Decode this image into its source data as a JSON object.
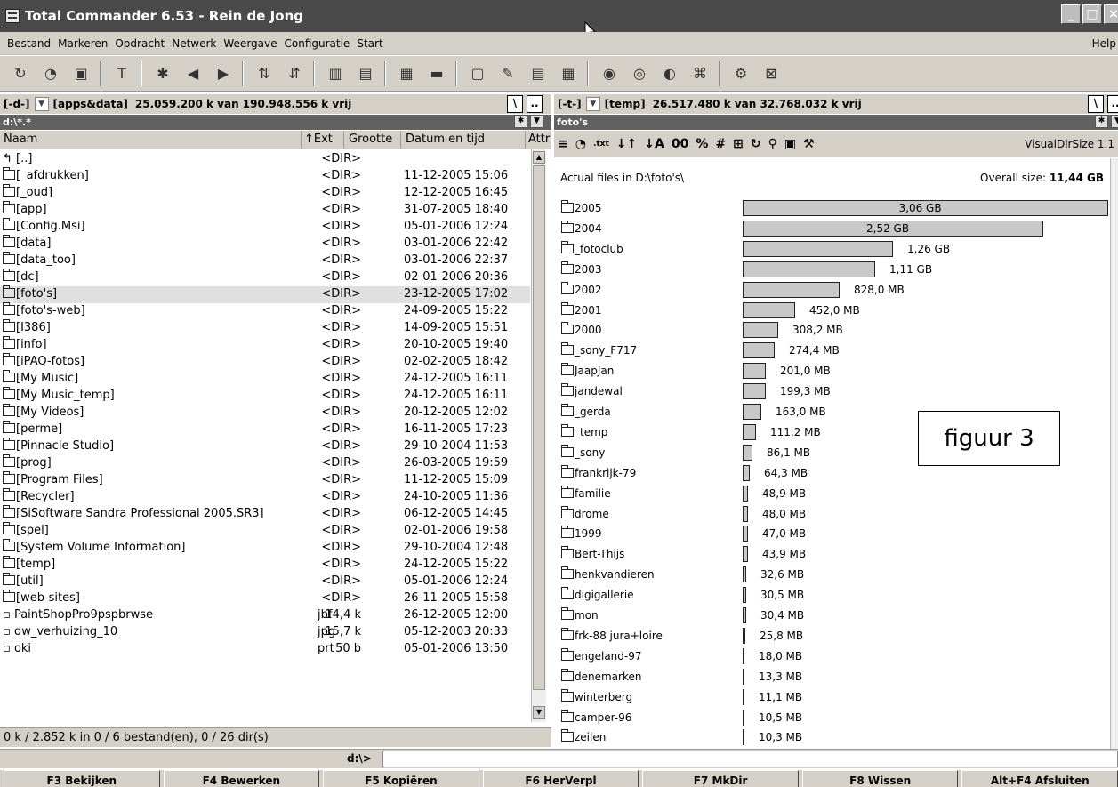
{
  "window": {
    "title": "Total Commander 6.53 - Rein de Jong"
  },
  "menu": {
    "items": [
      "Bestand",
      "Markeren",
      "Opdracht",
      "Netwerk",
      "Weergave",
      "Configuratie",
      "Start"
    ],
    "help": "Help"
  },
  "left": {
    "drive_label": "[-d-]",
    "volume": "[apps&data]",
    "space": "25.059.200 k van 190.948.556 k vrij",
    "path": "d:\\*.*",
    "headers": {
      "name": "Naam",
      "ext": "↑Ext",
      "size": "Grootte",
      "date": "Datum en tijd",
      "attr": "Attr"
    },
    "files": [
      {
        "name": "[..]",
        "ext": "",
        "size": "<DIR>",
        "date": "",
        "icon": "up"
      },
      {
        "name": "[_afdrukken]",
        "ext": "",
        "size": "<DIR>",
        "date": "11-12-2005 15:06",
        "icon": "folder"
      },
      {
        "name": "[_oud]",
        "ext": "",
        "size": "<DIR>",
        "date": "12-12-2005 16:45",
        "icon": "folder"
      },
      {
        "name": "[app]",
        "ext": "",
        "size": "<DIR>",
        "date": "31-07-2005 18:40",
        "icon": "folder"
      },
      {
        "name": "[Config.Msi]",
        "ext": "",
        "size": "<DIR>",
        "date": "05-01-2006 12:24",
        "icon": "folder"
      },
      {
        "name": "[data]",
        "ext": "",
        "size": "<DIR>",
        "date": "03-01-2006 22:42",
        "icon": "folder"
      },
      {
        "name": "[data_too]",
        "ext": "",
        "size": "<DIR>",
        "date": "03-01-2006 22:37",
        "icon": "folder"
      },
      {
        "name": "[dc]",
        "ext": "",
        "size": "<DIR>",
        "date": "02-01-2006 20:36",
        "icon": "folder"
      },
      {
        "name": "[foto's]",
        "ext": "",
        "size": "<DIR>",
        "date": "23-12-2005 17:02",
        "icon": "folder-special",
        "selected": true
      },
      {
        "name": "[foto's-web]",
        "ext": "",
        "size": "<DIR>",
        "date": "24-09-2005 15:22",
        "icon": "folder-special"
      },
      {
        "name": "[I386]",
        "ext": "",
        "size": "<DIR>",
        "date": "14-09-2005 15:51",
        "icon": "folder"
      },
      {
        "name": "[info]",
        "ext": "",
        "size": "<DIR>",
        "date": "20-10-2005 19:40",
        "icon": "folder"
      },
      {
        "name": "[iPAQ-fotos]",
        "ext": "",
        "size": "<DIR>",
        "date": "02-02-2005 18:42",
        "icon": "folder"
      },
      {
        "name": "[My Music]",
        "ext": "",
        "size": "<DIR>",
        "date": "24-12-2005 16:11",
        "icon": "folder"
      },
      {
        "name": "[My Music_temp]",
        "ext": "",
        "size": "<DIR>",
        "date": "24-12-2005 16:11",
        "icon": "folder"
      },
      {
        "name": "[My Videos]",
        "ext": "",
        "size": "<DIR>",
        "date": "20-12-2005 12:02",
        "icon": "folder"
      },
      {
        "name": "[perme]",
        "ext": "",
        "size": "<DIR>",
        "date": "16-11-2005 17:23",
        "icon": "folder"
      },
      {
        "name": "[Pinnacle Studio]",
        "ext": "",
        "size": "<DIR>",
        "date": "29-10-2004 11:53",
        "icon": "folder"
      },
      {
        "name": "[prog]",
        "ext": "",
        "size": "<DIR>",
        "date": "26-03-2005 19:59",
        "icon": "folder"
      },
      {
        "name": "[Program Files]",
        "ext": "",
        "size": "<DIR>",
        "date": "11-12-2005 15:09",
        "icon": "folder"
      },
      {
        "name": "[Recycler]",
        "ext": "",
        "size": "<DIR>",
        "date": "24-10-2005 11:36",
        "icon": "folder"
      },
      {
        "name": "[SiSoftware Sandra Professional 2005.SR3]",
        "ext": "",
        "size": "<DIR>",
        "date": "06-12-2005 14:45",
        "icon": "folder"
      },
      {
        "name": "[spel]",
        "ext": "",
        "size": "<DIR>",
        "date": "02-01-2006 19:58",
        "icon": "folder"
      },
      {
        "name": "[System Volume Information]",
        "ext": "",
        "size": "<DIR>",
        "date": "29-10-2004 12:48",
        "icon": "folder"
      },
      {
        "name": "[temp]",
        "ext": "",
        "size": "<DIR>",
        "date": "24-12-2005 15:22",
        "icon": "folder"
      },
      {
        "name": "[util]",
        "ext": "",
        "size": "<DIR>",
        "date": "05-01-2006 12:24",
        "icon": "folder"
      },
      {
        "name": "[web-sites]",
        "ext": "",
        "size": "<DIR>",
        "date": "26-11-2005 15:58",
        "icon": "folder"
      },
      {
        "name": "PaintShopPro9pspbrwse",
        "ext": "jbf",
        "size": "14,4 k",
        "date": "26-12-2005 12:00",
        "icon": "file-app"
      },
      {
        "name": "dw_verhuizing_10",
        "ext": "jpg",
        "size": "15,7 k",
        "date": "05-12-2003 20:33",
        "icon": "file-image"
      },
      {
        "name": "oki",
        "ext": "prt",
        "size": "50 b",
        "date": "05-01-2006 13:50",
        "icon": "file"
      }
    ],
    "status": "0 k / 2.852 k in 0 / 6 bestand(en), 0 / 26 dir(s)"
  },
  "right": {
    "drive_label": "[-t-]",
    "volume": "[temp]",
    "space": "26.517.480 k van 32.768.032 k vrij",
    "path": "foto's",
    "plugin_title": "VisualDirSize 1.1",
    "actual_files": "Actual files in  D:\\foto's\\",
    "overall_label": "Overall size:",
    "overall_value": "11,44 GB",
    "label_box": "figuur 3",
    "folders": [
      {
        "name": "2005",
        "size": "3,06 GB",
        "mb": 3133
      },
      {
        "name": "2004",
        "size": "2,52 GB",
        "mb": 2580
      },
      {
        "name": "_fotoclub",
        "size": "1,26 GB",
        "mb": 1290
      },
      {
        "name": "2003",
        "size": "1,11 GB",
        "mb": 1137
      },
      {
        "name": "2002",
        "size": "828,0 MB",
        "mb": 828
      },
      {
        "name": "2001",
        "size": "452,0 MB",
        "mb": 452
      },
      {
        "name": "2000",
        "size": "308,2 MB",
        "mb": 308.2
      },
      {
        "name": "_sony_F717",
        "size": "274,4 MB",
        "mb": 274.4
      },
      {
        "name": "JaapJan",
        "size": "201,0 MB",
        "mb": 201
      },
      {
        "name": "jandewal",
        "size": "199,3 MB",
        "mb": 199.3
      },
      {
        "name": "_gerda",
        "size": "163,0 MB",
        "mb": 163
      },
      {
        "name": "_temp",
        "size": "111,2 MB",
        "mb": 111.2
      },
      {
        "name": "_sony",
        "size": "86,1 MB",
        "mb": 86.1
      },
      {
        "name": "frankrijk-79",
        "size": "64,3 MB",
        "mb": 64.3
      },
      {
        "name": "familie",
        "size": "48,9 MB",
        "mb": 48.9
      },
      {
        "name": "drome",
        "size": "48,0 MB",
        "mb": 48
      },
      {
        "name": "1999",
        "size": "47,0 MB",
        "mb": 47
      },
      {
        "name": "Bert-Thijs",
        "size": "43,9 MB",
        "mb": 43.9
      },
      {
        "name": "henkvandieren",
        "size": "32,6 MB",
        "mb": 32.6
      },
      {
        "name": "digigallerie",
        "size": "30,5 MB",
        "mb": 30.5
      },
      {
        "name": "mon",
        "size": "30,4 MB",
        "mb": 30.4
      },
      {
        "name": "frk-88 jura+loire",
        "size": "25,8 MB",
        "mb": 25.8
      },
      {
        "name": "engeland-97",
        "size": "18,0 MB",
        "mb": 18
      },
      {
        "name": "denemarken",
        "size": "13,3 MB",
        "mb": 13.3
      },
      {
        "name": "winterberg",
        "size": "11,1 MB",
        "mb": 11.1
      },
      {
        "name": "camper-96",
        "size": "10,5 MB",
        "mb": 10.5
      },
      {
        "name": "zeilen",
        "size": "10,3 MB",
        "mb": 10.3
      }
    ]
  },
  "cmdline": {
    "prompt": "d:\\>"
  },
  "fkeys": [
    "F3 Bekijken",
    "F4 Bewerken",
    "F5 Kopiëren",
    "F6 HerVerpl",
    "F7 MkDir",
    "F8 Wissen",
    "Alt+F4 Afsluiten"
  ]
}
